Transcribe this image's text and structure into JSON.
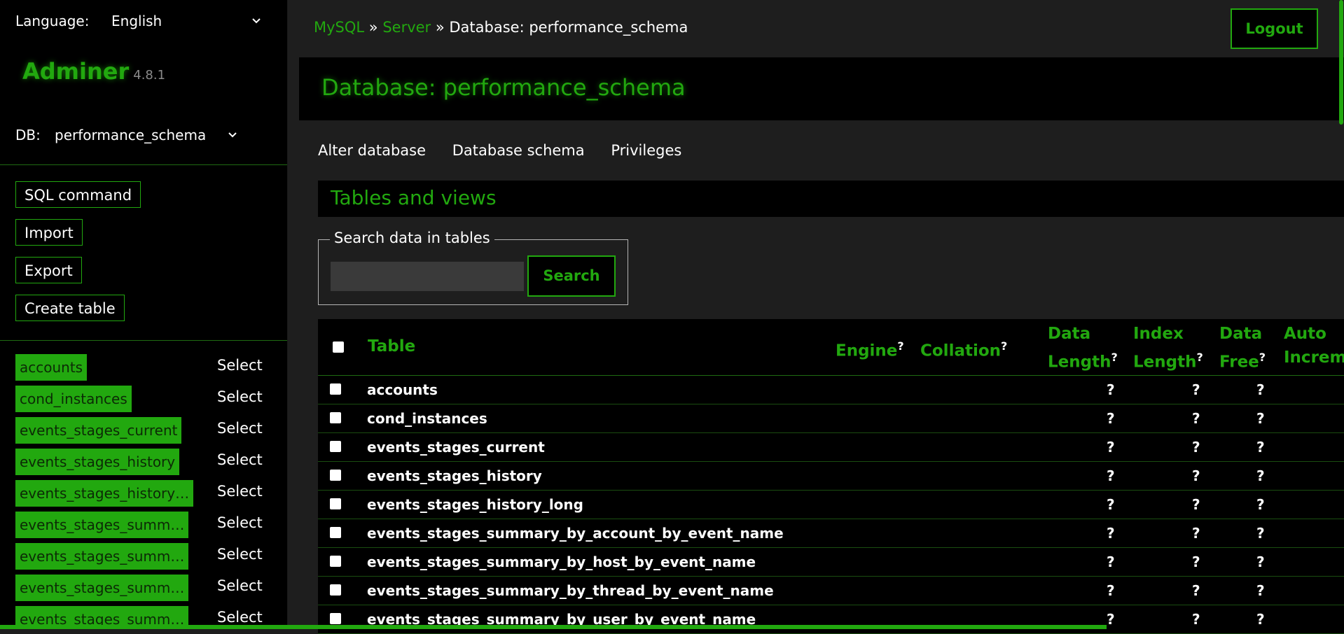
{
  "sidebar": {
    "language_label": "Language:",
    "language_value": "English",
    "app_name": "Adminer",
    "app_version": "4.8.1",
    "db_label": "DB:",
    "db_value": "performance_schema",
    "buttons": {
      "sql_command": "SQL command",
      "import": "Import",
      "export": "Export",
      "create_table": "Create table"
    },
    "tables": [
      {
        "name": "accounts",
        "action": "Select"
      },
      {
        "name": "cond_instances",
        "action": "Select"
      },
      {
        "name": "events_stages_current",
        "action": "Select"
      },
      {
        "name": "events_stages_history",
        "action": "Select"
      },
      {
        "name": "events_stages_history…",
        "action": "Select"
      },
      {
        "name": "events_stages_summ…",
        "action": "Select"
      },
      {
        "name": "events_stages_summ…",
        "action": "Select"
      },
      {
        "name": "events_stages_summ…",
        "action": "Select"
      },
      {
        "name": "events_stages_summ…",
        "action": "Select"
      }
    ]
  },
  "header": {
    "breadcrumb": {
      "mysql": "MySQL",
      "sep1": " » ",
      "server": "Server",
      "sep2": " » ",
      "current": "Database: performance_schema"
    },
    "logout_label": "Logout"
  },
  "main": {
    "title": "Database: performance_schema",
    "links": {
      "alter": "Alter database",
      "schema": "Database schema",
      "privileges": "Privileges"
    },
    "section_title": "Tables and views",
    "search": {
      "legend": "Search data in tables",
      "placeholder": "",
      "button": "Search"
    },
    "table": {
      "columns": {
        "table": "Table",
        "engine": "Engine",
        "collation": "Collation",
        "data_length_1": "Data",
        "data_length_2": "Length",
        "index_length_1": "Index",
        "index_length_2": "Length",
        "data_free_1": "Data",
        "data_free_2": "Free",
        "auto_incr_1": "Auto",
        "auto_incr_2": "Increm",
        "help_mark": "?"
      },
      "rows": [
        {
          "name": "accounts",
          "data_length": "?",
          "index_length": "?",
          "data_free": "?"
        },
        {
          "name": "cond_instances",
          "data_length": "?",
          "index_length": "?",
          "data_free": "?"
        },
        {
          "name": "events_stages_current",
          "data_length": "?",
          "index_length": "?",
          "data_free": "?"
        },
        {
          "name": "events_stages_history",
          "data_length": "?",
          "index_length": "?",
          "data_free": "?"
        },
        {
          "name": "events_stages_history_long",
          "data_length": "?",
          "index_length": "?",
          "data_free": "?"
        },
        {
          "name": "events_stages_summary_by_account_by_event_name",
          "data_length": "?",
          "index_length": "?",
          "data_free": "?"
        },
        {
          "name": "events_stages_summary_by_host_by_event_name",
          "data_length": "?",
          "index_length": "?",
          "data_free": "?"
        },
        {
          "name": "events_stages_summary_by_thread_by_event_name",
          "data_length": "?",
          "index_length": "?",
          "data_free": "?"
        },
        {
          "name": "events_stages_summary_by_user_by_event_name",
          "data_length": "?",
          "index_length": "?",
          "data_free": "?"
        }
      ]
    }
  },
  "colors": {
    "accent": "#22a80f",
    "background": "#1e1e1e",
    "sidebar": "#000000"
  }
}
